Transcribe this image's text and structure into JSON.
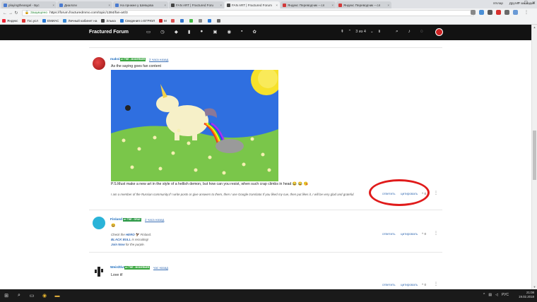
{
  "browser": {
    "tabs": [
      {
        "label": "playingtheangel - Бус",
        "fav": "blue"
      },
      {
        "label": "Диалоги",
        "fav": "blue"
      },
      {
        "label": "На прнжне у Шевцова",
        "fav": "blue"
      },
      {
        "label": "FAN ART | Fractured Foru",
        "fav": "dark"
      },
      {
        "label": "FAN ART | Fractured Forum",
        "fav": "dark",
        "active": true
      },
      {
        "label": "Яндекс Переводчик – сл",
        "fav": "red"
      },
      {
        "label": "Яндекс Переводчик – сл",
        "fav": "red"
      }
    ],
    "user_name": "Иллар",
    "secure_label": "Защищено",
    "url": "https://forum.fracturedmmo.com/topic/1384/fan-art/3",
    "bookmarks": [
      "Яндекс",
      "Гос.усл",
      "ЕМИАС",
      "Личный кабинет на",
      "Злыка",
      "Сведения о ЕГРЮЛ",
      "M",
      "",
      "",
      "",
      "",
      "",
      ""
    ],
    "bookmarks_other": "Другие закладки"
  },
  "site": {
    "title": "Fractured Forum",
    "pager": "3 из 4",
    "header_icons": [
      "inbox-icon",
      "clock-icon",
      "tags-icon",
      "chart-icon",
      "users-icon",
      "twitch-icon",
      "steam-icon",
      "vk-icon",
      "gear-icon"
    ]
  },
  "posts": [
    {
      "author": "maksi",
      "badge": "лт ТНЕ - MODERNER",
      "time": "2 часа назад",
      "text": "As the saying goes fan content",
      "ps": "P.S.Must make a new art in the style of a hellish demon, but how can you resist, when such crap climbs in head 😂 😂 😘",
      "signature": "I am a member of the Russian community.If I write posts or give answers to them, then I use Google translator.If you liked my cue, then put likes it, I will be very glad and grateful.",
      "reply": "ответить",
      "quote": "цитировать",
      "votes": "0"
    },
    {
      "author": "Finland",
      "badge": "лт ТНЕ - GRAY",
      "time": "2 часа назад",
      "text": "😆",
      "sig_lines": [
        {
          "pre": "Check the ",
          "link": "HERO",
          "post": " 🦅 Finland."
        },
        {
          "pre": "",
          "link": "BLACK BULL",
          "post": " is recruiting!"
        },
        {
          "pre": "",
          "link": "Join Now",
          "post": " for the purple."
        }
      ],
      "reply": "ответить",
      "quote": "цитировать",
      "votes": "0"
    },
    {
      "author": "Weirdtive",
      "badge": "лт ТНЕ - MODERNER",
      "time": "час назад",
      "text": "Love it!",
      "reply": "ответить",
      "quote": "цитировать",
      "votes": "0"
    }
  ],
  "taskbar": {
    "time": "21:08",
    "date": "19.02.2018",
    "lang": "РУС"
  }
}
